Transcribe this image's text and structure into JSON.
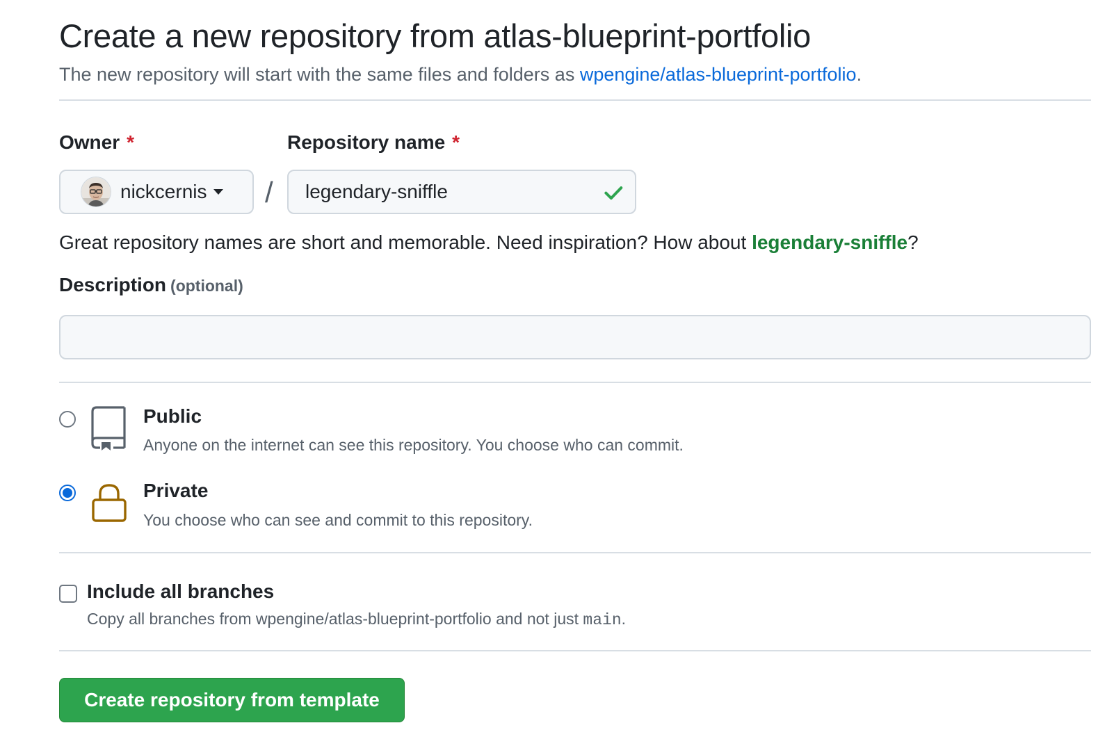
{
  "header": {
    "title": "Create a new repository from atlas-blueprint-portfolio",
    "subtitle_prefix": "The new repository will start with the same files and folders as ",
    "template_link": "wpengine/atlas-blueprint-portfolio",
    "subtitle_suffix": "."
  },
  "owner": {
    "label": "Owner",
    "required_mark": "*",
    "value": "nickcernis"
  },
  "separator": "/",
  "repo_name": {
    "label": "Repository name",
    "required_mark": "*",
    "value": "legendary-sniffle",
    "valid_icon": "check-icon",
    "valid_color": "#2da44e"
  },
  "hint": {
    "prefix": "Great repository names are short and memorable. Need inspiration? How about ",
    "suggestion": "legendary-sniffle",
    "suffix": "?"
  },
  "description": {
    "label": "Description",
    "optional": "(optional)",
    "value": ""
  },
  "visibility": {
    "selected": "private",
    "options": [
      {
        "id": "public",
        "title": "Public",
        "description": "Anyone on the internet can see this repository. You choose who can commit.",
        "icon": "repo-icon",
        "checked": false
      },
      {
        "id": "private",
        "title": "Private",
        "description": "You choose who can see and commit to this repository.",
        "icon": "lock-icon",
        "icon_color": "#9a6700",
        "checked": true
      }
    ]
  },
  "include_branches": {
    "label": "Include all branches",
    "checked": false,
    "description_prefix": "Copy all branches from wpengine/atlas-blueprint-portfolio and not just ",
    "branch": "main",
    "description_suffix": "."
  },
  "submit": {
    "label": "Create repository from template",
    "color": "#2da44e"
  },
  "colors": {
    "link": "#0969da",
    "suggestion": "#1a7f37",
    "required": "#cf222e",
    "radio_selected": "#0969da"
  }
}
